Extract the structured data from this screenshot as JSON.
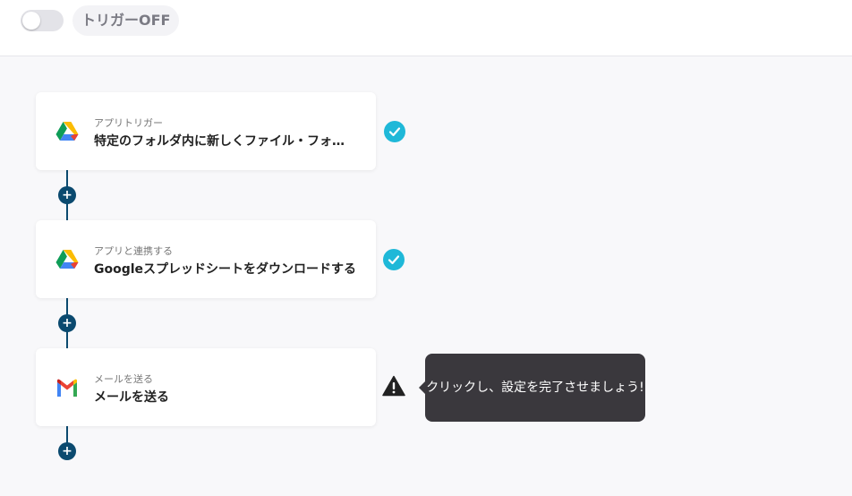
{
  "header": {
    "trigger_toggle_on": false,
    "trigger_label": "トリガーOFF"
  },
  "steps": [
    {
      "subtitle": "アプリトリガー",
      "title": "特定のフォルダ内に新しくファイル・フォ…",
      "app_icon": "google-drive-icon",
      "status": "complete",
      "status_icon": "check-icon"
    },
    {
      "subtitle": "アプリと連携する",
      "title": "Googleスプレッドシートをダウンロードする",
      "app_icon": "google-drive-icon",
      "status": "complete",
      "status_icon": "check-icon"
    },
    {
      "subtitle": "メールを送る",
      "title": "メールを送る",
      "app_icon": "gmail-icon",
      "status": "incomplete",
      "status_icon": "warning-icon"
    }
  ],
  "add_step_icon": "plus-icon",
  "tooltip": {
    "text": "クリックし、設定を完了させましょう!"
  },
  "colors": {
    "connector": "#0b4a6f",
    "check": "#1fb8d8",
    "tooltip_bg": "#3a383d"
  }
}
